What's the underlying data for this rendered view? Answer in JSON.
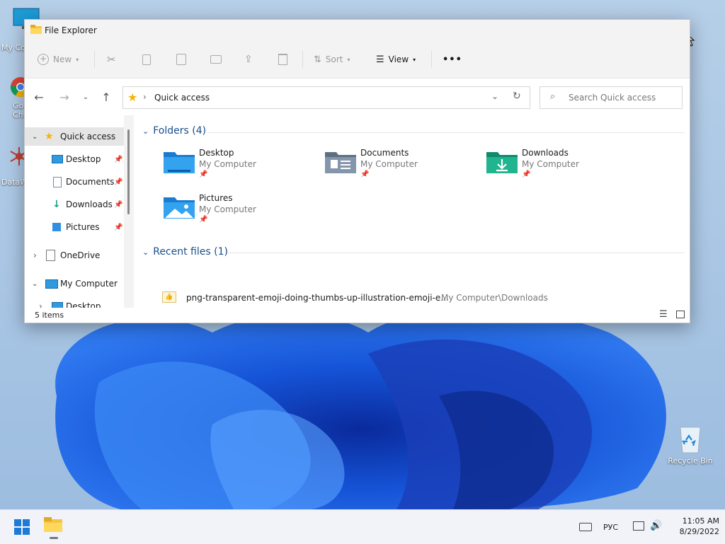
{
  "desktop": {
    "icons": [
      {
        "label": "My Co",
        "name": "my-computer-desktop-icon"
      },
      {
        "label": "Go Chr",
        "name": "google-chrome-desktop-icon"
      },
      {
        "label": "DataW",
        "name": "datawrapper-desktop-icon"
      }
    ],
    "recycle_bin_label": "Recycle Bin"
  },
  "window": {
    "title": "File Explorer",
    "toolbar": {
      "new_label": "New",
      "sort_label": "Sort",
      "view_label": "View",
      "more_label": "•••"
    },
    "address": {
      "current": "Quick access",
      "search_placeholder": "Search Quick access"
    },
    "sidebar": {
      "quick_access": "Quick access",
      "items": [
        {
          "label": "Desktop"
        },
        {
          "label": "Documents"
        },
        {
          "label": "Downloads"
        },
        {
          "label": "Pictures"
        }
      ],
      "onedrive": "OneDrive",
      "my_computer": "My Computer",
      "my_computer_child": "Desktop"
    },
    "folders_section": "Folders (4)",
    "folders": [
      {
        "name": "Desktop",
        "location": "My Computer"
      },
      {
        "name": "Documents",
        "location": "My Computer"
      },
      {
        "name": "Downloads",
        "location": "My Computer"
      },
      {
        "name": "Pictures",
        "location": "My Computer"
      }
    ],
    "recent_section": "Recent files (1)",
    "recent_files": [
      {
        "name": "png-transparent-emoji-doing-thumbs-up-illustration-emoji-e...",
        "path": "My Computer\\Downloads"
      }
    ],
    "status": "5 items"
  },
  "taskbar": {
    "language": "РУС",
    "time": "11:05 AM",
    "date": "8/29/2022"
  },
  "colors": {
    "accent": "#0067c0",
    "folder_blue": "#2f8fe0",
    "downloads_green": "#18a383"
  }
}
